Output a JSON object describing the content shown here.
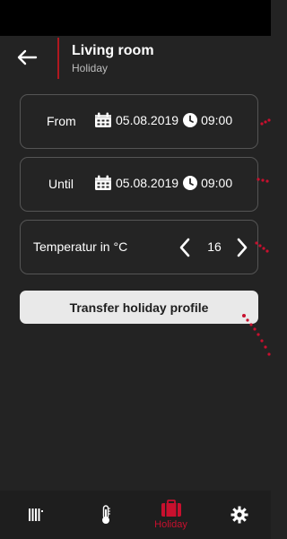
{
  "header": {
    "title": "Living room",
    "subtitle": "Holiday",
    "back_icon": "arrow-left-icon"
  },
  "from": {
    "label": "From",
    "date": "05.08.2019",
    "time": "09:00"
  },
  "until": {
    "label": "Until",
    "date": "05.08.2019",
    "time": "09:00"
  },
  "temperature": {
    "label": "Temperatur in °C",
    "value": "16"
  },
  "transfer_button": {
    "label": "Transfer holiday profile"
  },
  "nav": {
    "items": [
      {
        "icon": "radiator-icon",
        "label": ""
      },
      {
        "icon": "thermometer-icon",
        "label": ""
      },
      {
        "icon": "suitcase-icon",
        "label": "Holiday",
        "active": true
      },
      {
        "icon": "gear-icon",
        "label": ""
      }
    ]
  },
  "colors": {
    "background": "#232323",
    "accent": "#c8102e",
    "card_border": "#555555",
    "button_bg": "#e9e9e9"
  }
}
